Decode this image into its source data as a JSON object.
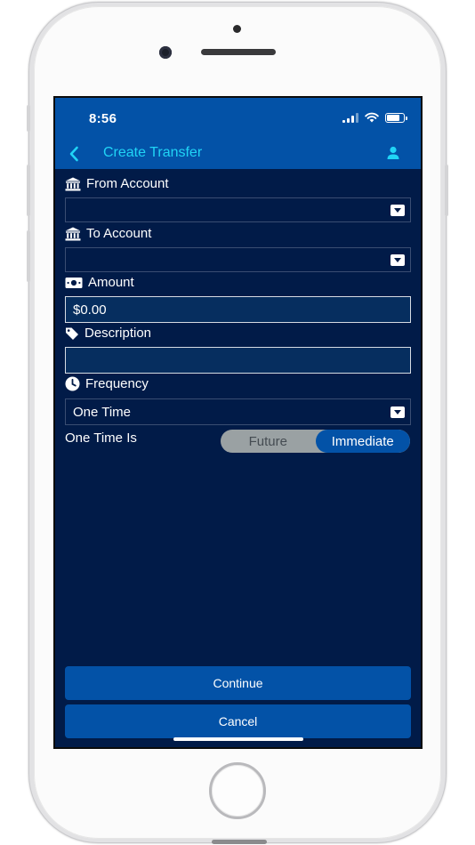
{
  "status": {
    "time": "8:56"
  },
  "header": {
    "title": "Create Transfer"
  },
  "form": {
    "from_account": {
      "label": "From Account",
      "value": ""
    },
    "to_account": {
      "label": "To Account",
      "value": ""
    },
    "amount": {
      "label": "Amount",
      "value": "$0.00"
    },
    "description": {
      "label": "Description",
      "value": ""
    },
    "frequency": {
      "label": "Frequency",
      "value": "One Time"
    },
    "one_time": {
      "label": "One Time Is",
      "options": [
        "Future",
        "Immediate"
      ],
      "selected": "Immediate"
    }
  },
  "actions": {
    "continue_label": "Continue",
    "cancel_label": "Cancel"
  },
  "colors": {
    "background": "#011b48",
    "header": "#0352a7",
    "accent": "#20d4f6",
    "button": "#0352a7"
  },
  "icons": [
    "chevron-left-icon",
    "person-icon",
    "bank-icon",
    "cash-icon",
    "tag-icon",
    "clock-icon",
    "caret-down-icon",
    "wifi-icon",
    "signal-icon",
    "battery-icon"
  ]
}
